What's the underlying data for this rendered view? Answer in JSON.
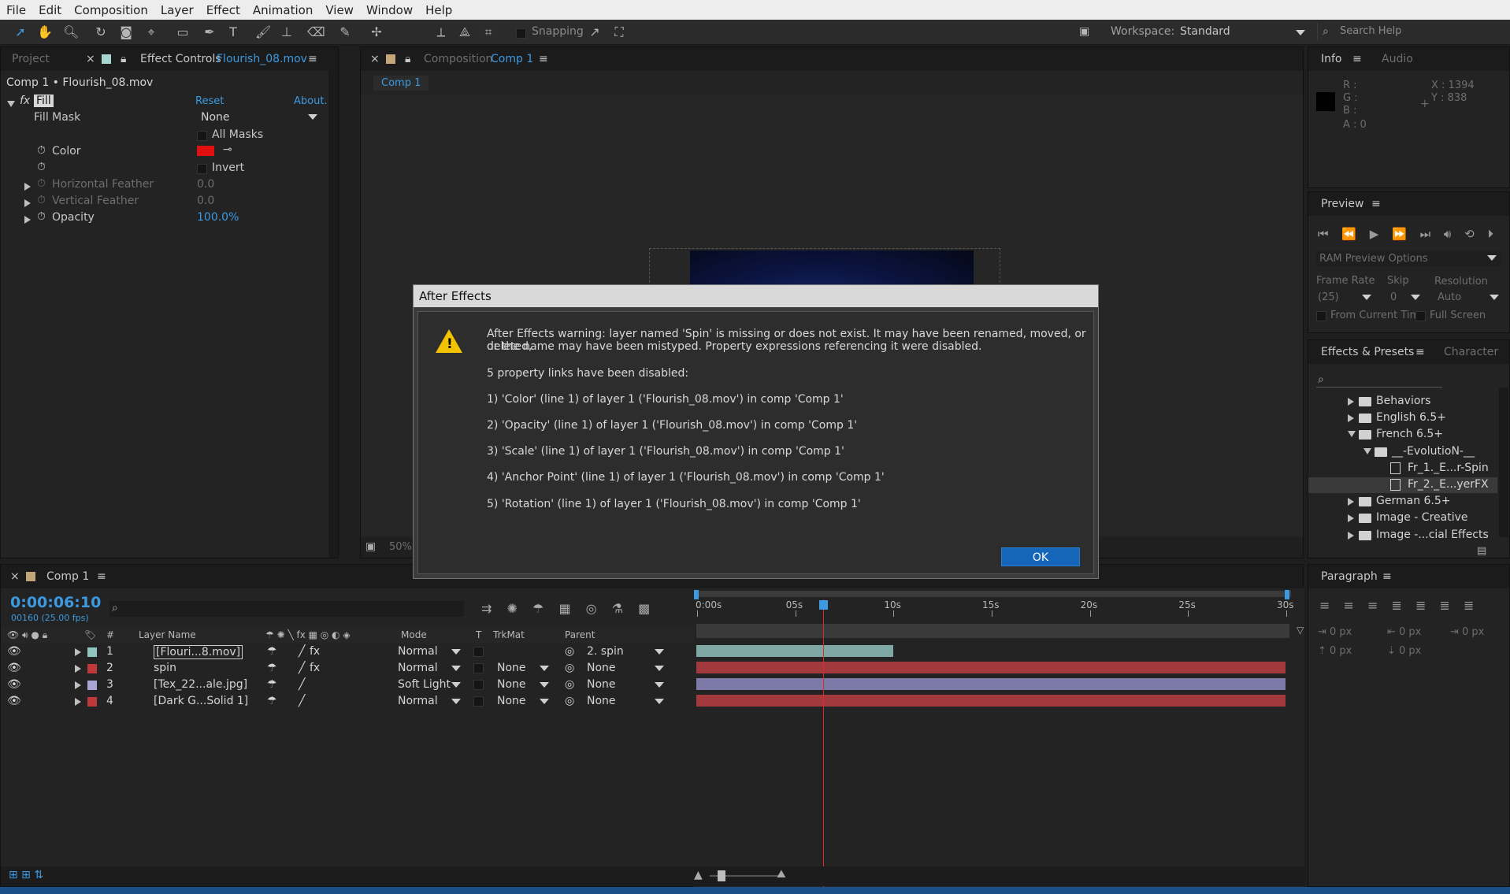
{
  "menu": [
    "File",
    "Edit",
    "Composition",
    "Layer",
    "Effect",
    "Animation",
    "View",
    "Window",
    "Help"
  ],
  "toolbar": {
    "snapping_label": "Snapping",
    "workspace_label": "Workspace:",
    "workspace_value": "Standard",
    "search_placeholder": "Search Help"
  },
  "left_panel": {
    "tab_project": "Project",
    "tab_effect_controls": "Effect Controls",
    "tab_effect_target": "Flourish_08.mov",
    "breadcrumb": "Comp 1 • Flourish_08.mov",
    "effect_name": "Fill",
    "reset": "Reset",
    "about": "About...",
    "fill_mask_label": "Fill Mask",
    "fill_mask_value": "None",
    "all_masks": "All Masks",
    "color_label": "Color",
    "color_value": "#e01010",
    "invert": "Invert",
    "h_feather_label": "Horizontal Feather",
    "h_feather_value": "0.0",
    "v_feather_label": "Vertical Feather",
    "v_feather_value": "0.0",
    "opacity_label": "Opacity",
    "opacity_value": "100.0%"
  },
  "comp_panel": {
    "tab_label": "Composition",
    "tab_target": "Comp 1",
    "subtab": "Comp 1",
    "zoom": "50%"
  },
  "info_panel": {
    "tab_info": "Info",
    "tab_audio": "Audio",
    "r": "R :",
    "g": "G :",
    "b": "B :",
    "a": "A : 0",
    "x": "X : 1394",
    "y": "Y : 838"
  },
  "preview_panel": {
    "title": "Preview",
    "ram_options": "RAM Preview Options",
    "frame_rate_label": "Frame Rate",
    "skip_label": "Skip",
    "resolution_label": "Resolution",
    "frame_rate_value": "(25)",
    "skip_value": "0",
    "resolution_value": "Auto",
    "from_current": "From Current Time",
    "full_screen": "Full Screen"
  },
  "effects_panel": {
    "tab_effects": "Effects & Presets",
    "tab_character": "Character",
    "items": [
      {
        "label": "Behaviors",
        "kind": "folder",
        "open": false
      },
      {
        "label": "English 6.5+",
        "kind": "folder",
        "open": false
      },
      {
        "label": "French 6.5+",
        "kind": "folder",
        "open": true
      },
      {
        "label": "__-EvolutioN-__",
        "kind": "folder",
        "open": true
      },
      {
        "label": "Fr_1._E...r-Spin",
        "kind": "preset",
        "open": false
      },
      {
        "label": "Fr_2._E...yerFX",
        "kind": "preset",
        "open": false
      },
      {
        "label": "German 6.5+",
        "kind": "folder",
        "open": false
      },
      {
        "label": "Image - Creative",
        "kind": "folder",
        "open": false
      },
      {
        "label": "Image -...cial Effects",
        "kind": "folder",
        "open": false
      }
    ]
  },
  "paragraph_panel": {
    "title": "Paragraph",
    "indent_values": [
      "0 px",
      "0 px",
      "0 px",
      "0 px",
      "0 px"
    ]
  },
  "timeline": {
    "tab_label": "Comp 1",
    "timecode": "0:00:06:10",
    "frame_info": "00160 (25.00 fps)",
    "col_hash": "#",
    "col_layer_name": "Layer Name",
    "col_mode": "Mode",
    "col_t": "T",
    "col_trkmat": "TrkMat",
    "col_parent": "Parent",
    "ruler": [
      "0:00s",
      "05s",
      "10s",
      "15s",
      "20s",
      "25s",
      "30s"
    ],
    "layers": [
      {
        "num": "1",
        "name": "[Flouri...8.mov]",
        "label_color": "#8fc7c0",
        "mode": "Normal",
        "trkmat": "",
        "parent": "2. spin",
        "bar_color": "#7fa8a4",
        "bar_end": 0.334
      },
      {
        "num": "2",
        "name": "spin",
        "label_color": "#c0393a",
        "mode": "Normal",
        "trkmat": "None",
        "parent": "None",
        "bar_color": "#a2393d",
        "bar_end": 1.0
      },
      {
        "num": "3",
        "name": "[Tex_22...ale.jpg]",
        "label_color": "#a9a6d6",
        "mode": "Soft Light",
        "trkmat": "None",
        "parent": "None",
        "bar_color": "#7d7aa8",
        "bar_end": 1.0
      },
      {
        "num": "4",
        "name": "[Dark G...Solid 1]",
        "label_color": "#c0393a",
        "mode": "Normal",
        "trkmat": "None",
        "parent": "None",
        "bar_color": "#a2393d",
        "bar_end": 1.0
      }
    ],
    "playhead_fraction": 0.214
  },
  "dialog": {
    "title": "After Effects",
    "message": "After Effects warning: layer named 'Spin' is missing or does not exist. It may have been renamed, moved, or deleted,",
    "message2": "or the name may have been mistyped. Property expressions referencing it were disabled.",
    "summary": "5 property links have been disabled:",
    "items": [
      "1)   'Color' (line 1) of layer 1 ('Flourish_08.mov') in comp 'Comp 1'",
      "2)   'Opacity' (line 1) of layer 1 ('Flourish_08.mov') in comp 'Comp 1'",
      "3)   'Scale' (line 1) of layer 1 ('Flourish_08.mov') in comp 'Comp 1'",
      "4)   'Anchor Point' (line 1) of layer 1 ('Flourish_08.mov') in comp 'Comp 1'",
      "5)   'Rotation' (line 1) of layer 1 ('Flourish_08.mov') in comp 'Comp 1'"
    ],
    "ok_label": "OK"
  }
}
